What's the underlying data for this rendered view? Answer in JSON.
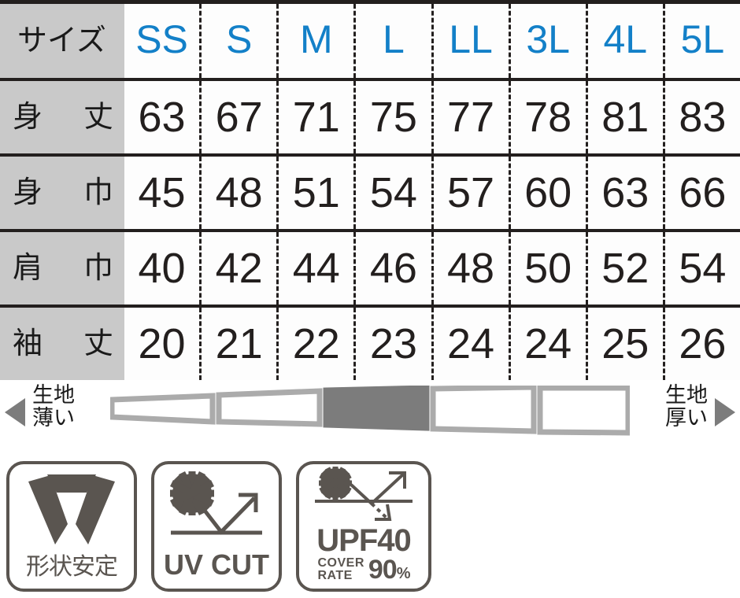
{
  "table": {
    "size_header_label": "サイズ",
    "sizes": [
      "SS",
      "S",
      "M",
      "L",
      "LL",
      "3L",
      "4L",
      "5L"
    ],
    "size_color": "#1380c8",
    "label_bg": "#c9c9c9",
    "rows": [
      {
        "label_a": "身",
        "label_b": "丈",
        "values": [
          "63",
          "67",
          "71",
          "75",
          "77",
          "78",
          "81",
          "83"
        ]
      },
      {
        "label_a": "身",
        "label_b": "巾",
        "values": [
          "45",
          "48",
          "51",
          "54",
          "57",
          "60",
          "63",
          "66"
        ]
      },
      {
        "label_a": "肩",
        "label_b": "巾",
        "values": [
          "40",
          "42",
          "44",
          "46",
          "48",
          "50",
          "52",
          "54"
        ]
      },
      {
        "label_a": "袖",
        "label_b": "丈",
        "values": [
          "20",
          "21",
          "22",
          "23",
          "24",
          "24",
          "25",
          "26"
        ]
      }
    ]
  },
  "gauge": {
    "left_line1": "生地",
    "left_line2": "薄い",
    "right_line1": "生地",
    "right_line2": "厚い",
    "steps": 5,
    "active_step": 3,
    "active_color": "#7c7c7c",
    "outline_color": "#ababab"
  },
  "badges": [
    {
      "name": "shape-retention",
      "icon": "collar-icon",
      "caption": "形状安定"
    },
    {
      "name": "uv-cut",
      "icon": "sun-reflect-icon",
      "caption": "UV CUT"
    },
    {
      "name": "upf40",
      "icon": "sun-block-icon",
      "caption_main": "UPF40",
      "caption_sub_line1": "COVER",
      "caption_sub_line2": "RATE",
      "caption_pct": "90",
      "caption_pct_symbol": "%"
    }
  ]
}
